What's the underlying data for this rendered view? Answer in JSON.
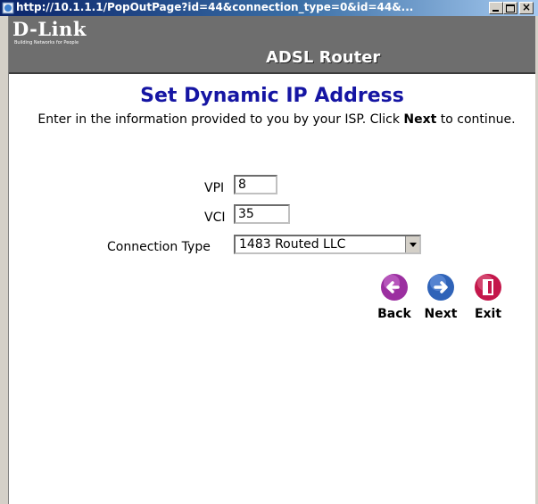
{
  "window": {
    "title": "http://10.1.1.1/PopOutPage?id=44&connection_type=0&id=44&..."
  },
  "header": {
    "logo": "D-Link",
    "logo_tagline": "Building Networks for People",
    "product": "ADSL Router"
  },
  "main": {
    "title": "Set Dynamic IP Address",
    "instructions_prefix": "Enter in the information provided to you by your ISP. Click ",
    "instructions_bold": "Next",
    "instructions_suffix": " to continue.",
    "vpi_label": "VPI",
    "vpi_value": "8",
    "vci_label": "VCI",
    "vci_value": "35",
    "connection_type_label": "Connection Type",
    "connection_type_value": "1483 Routed LLC"
  },
  "nav": {
    "back_label": "Back",
    "next_label": "Next",
    "exit_label": "Exit"
  },
  "colors": {
    "title_blue": "#1515a3",
    "icon_purple": "#9b2fa0",
    "icon_blue": "#2f63b8",
    "icon_red": "#c4174b"
  }
}
